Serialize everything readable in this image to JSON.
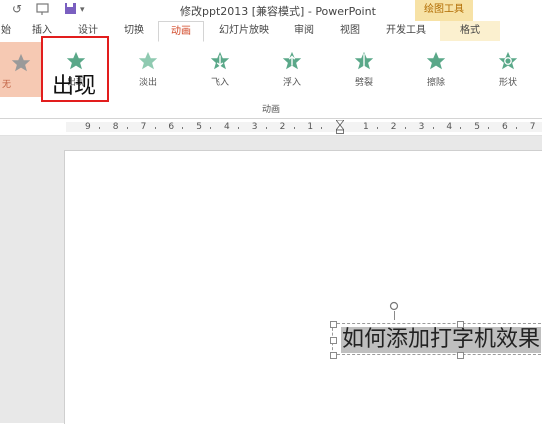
{
  "titlebar": {
    "title": "修改ppt2013 [兼容模式] - PowerPoint",
    "context_group_label": "绘图工具",
    "icons": [
      "undo-icon",
      "presentation-icon",
      "save-icon",
      "dropdown-icon"
    ]
  },
  "tabs": [
    {
      "label": "始",
      "state": "normal"
    },
    {
      "label": "插入",
      "state": "normal"
    },
    {
      "label": "设计",
      "state": "normal"
    },
    {
      "label": "切换",
      "state": "normal"
    },
    {
      "label": "动画",
      "state": "active"
    },
    {
      "label": "幻灯片放映",
      "state": "normal"
    },
    {
      "label": "审阅",
      "state": "normal"
    },
    {
      "label": "视图",
      "state": "normal"
    },
    {
      "label": "开发工具",
      "state": "normal"
    },
    {
      "label": "格式",
      "state": "context"
    }
  ],
  "ribbon": {
    "gallery": [
      {
        "label": "无",
        "icon": "star-none-icon",
        "selected": true
      },
      {
        "label": "出现",
        "icon": "star-appear-icon",
        "selected": false
      },
      {
        "label": "淡出",
        "icon": "star-fade-icon",
        "selected": false
      },
      {
        "label": "飞入",
        "icon": "star-flyin-icon",
        "selected": false
      },
      {
        "label": "浮入",
        "icon": "star-floatin-icon",
        "selected": false
      },
      {
        "label": "劈裂",
        "icon": "star-split-icon",
        "selected": false
      },
      {
        "label": "擦除",
        "icon": "star-wipe-icon",
        "selected": false
      },
      {
        "label": "形状",
        "icon": "star-shape-icon",
        "selected": false
      }
    ],
    "group_label": "动画",
    "callout_text": "出现"
  },
  "ruler": {
    "numbers": [
      "9",
      "8",
      "7",
      "6",
      "5",
      "4",
      "3",
      "2",
      "1",
      "1",
      "2",
      "3",
      "4",
      "5",
      "6",
      "7"
    ]
  },
  "slide": {
    "textbox_text": "如何添加打字机效果"
  },
  "colors": {
    "accent": "#d24726",
    "star": "#5aa889",
    "none_item_bg": "#f6c9b3",
    "highlight": "#e21d1d",
    "context_tab": "#f7e2a6"
  }
}
